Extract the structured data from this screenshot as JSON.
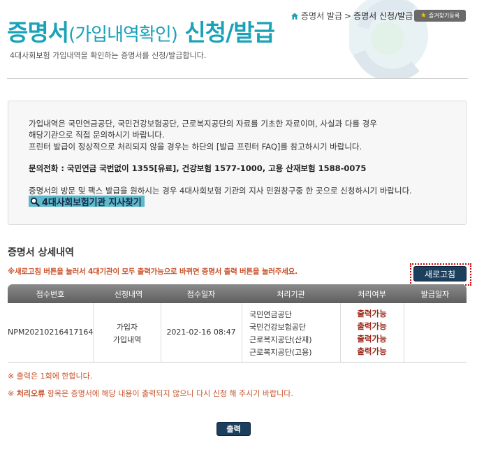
{
  "header": {
    "title_main": "증명서",
    "title_paren": "(가입내역확인)",
    "title_rest": " 신청/발급",
    "subtitle": "4대사회보험 가입내역을 확인하는 증명서를 신청/발급합니다.",
    "breadcrumb": [
      "증명서 발급",
      ">",
      "증명서 신청/발급"
    ],
    "favorite_label": "즐겨찾기등록"
  },
  "info": {
    "lines": [
      "가입내역은 국민연금공단, 국민건강보험공단, 근로복지공단의 자료를 기초한 자료이며, 사실과 다를 경우",
      "해당기관으로 직접 문의하시기 바랍니다.",
      "프린터 발급이 정상적으로 처리되지 않을 경우는 하단의 [발급 프린터 FAQ]를 참고하시기 바랍니다."
    ],
    "phone": "문의전화 : 국민연금 국번없이 1355[유료], 건강보험 1577-1000, 고용 산재보험 1588-0075",
    "visit": "증명서의 방문 및 팩스 발급을 원하시는 경우 4대사회보험 기관의 지사 민원창구중 한 곳으로 신청하시기 바랍니다.",
    "branch_link": "4대사회보험기관 지사찾기"
  },
  "detail": {
    "section_title": "증명서 상세내역",
    "notice": "※새로고침 버튼을 눌러서 4대기관이 모두 출력가능으로 바뀌면 증명서 출력 버튼을 눌러주세요.",
    "refresh_label": "새로고침",
    "columns": [
      "접수번호",
      "신청내역",
      "접수일자",
      "처리기관",
      "처리여부",
      "발급일자"
    ],
    "row": {
      "receipt_no": "NPM20210216417164",
      "request": [
        "가입자",
        "가입내역"
      ],
      "date": "2021-02-16 08:47",
      "agencies": [
        "국민연금공단",
        "국민건강보험공단",
        "근로복지공단(산재)",
        "근로복지공단(고용)"
      ],
      "statuses": [
        "출력가능",
        "출력가능",
        "출력가능",
        "출력가능"
      ],
      "issue_date": ""
    },
    "notes": {
      "note1": "※ 출력은 1회에 한합니다.",
      "note2_prefix": "※ ",
      "note2_bold": "처리오류",
      "note2_rest": " 항목은 증명서에 해당 내용이 출력되지 않으니 다시 신청 해 주시기 바랍니다."
    },
    "print_label": "출력"
  },
  "colors": {
    "title": "#1aa2b8",
    "notice": "#c9512a",
    "status": "#9a2a1a",
    "button": "#1d3f5e",
    "highlight_border": "#cc0000"
  }
}
